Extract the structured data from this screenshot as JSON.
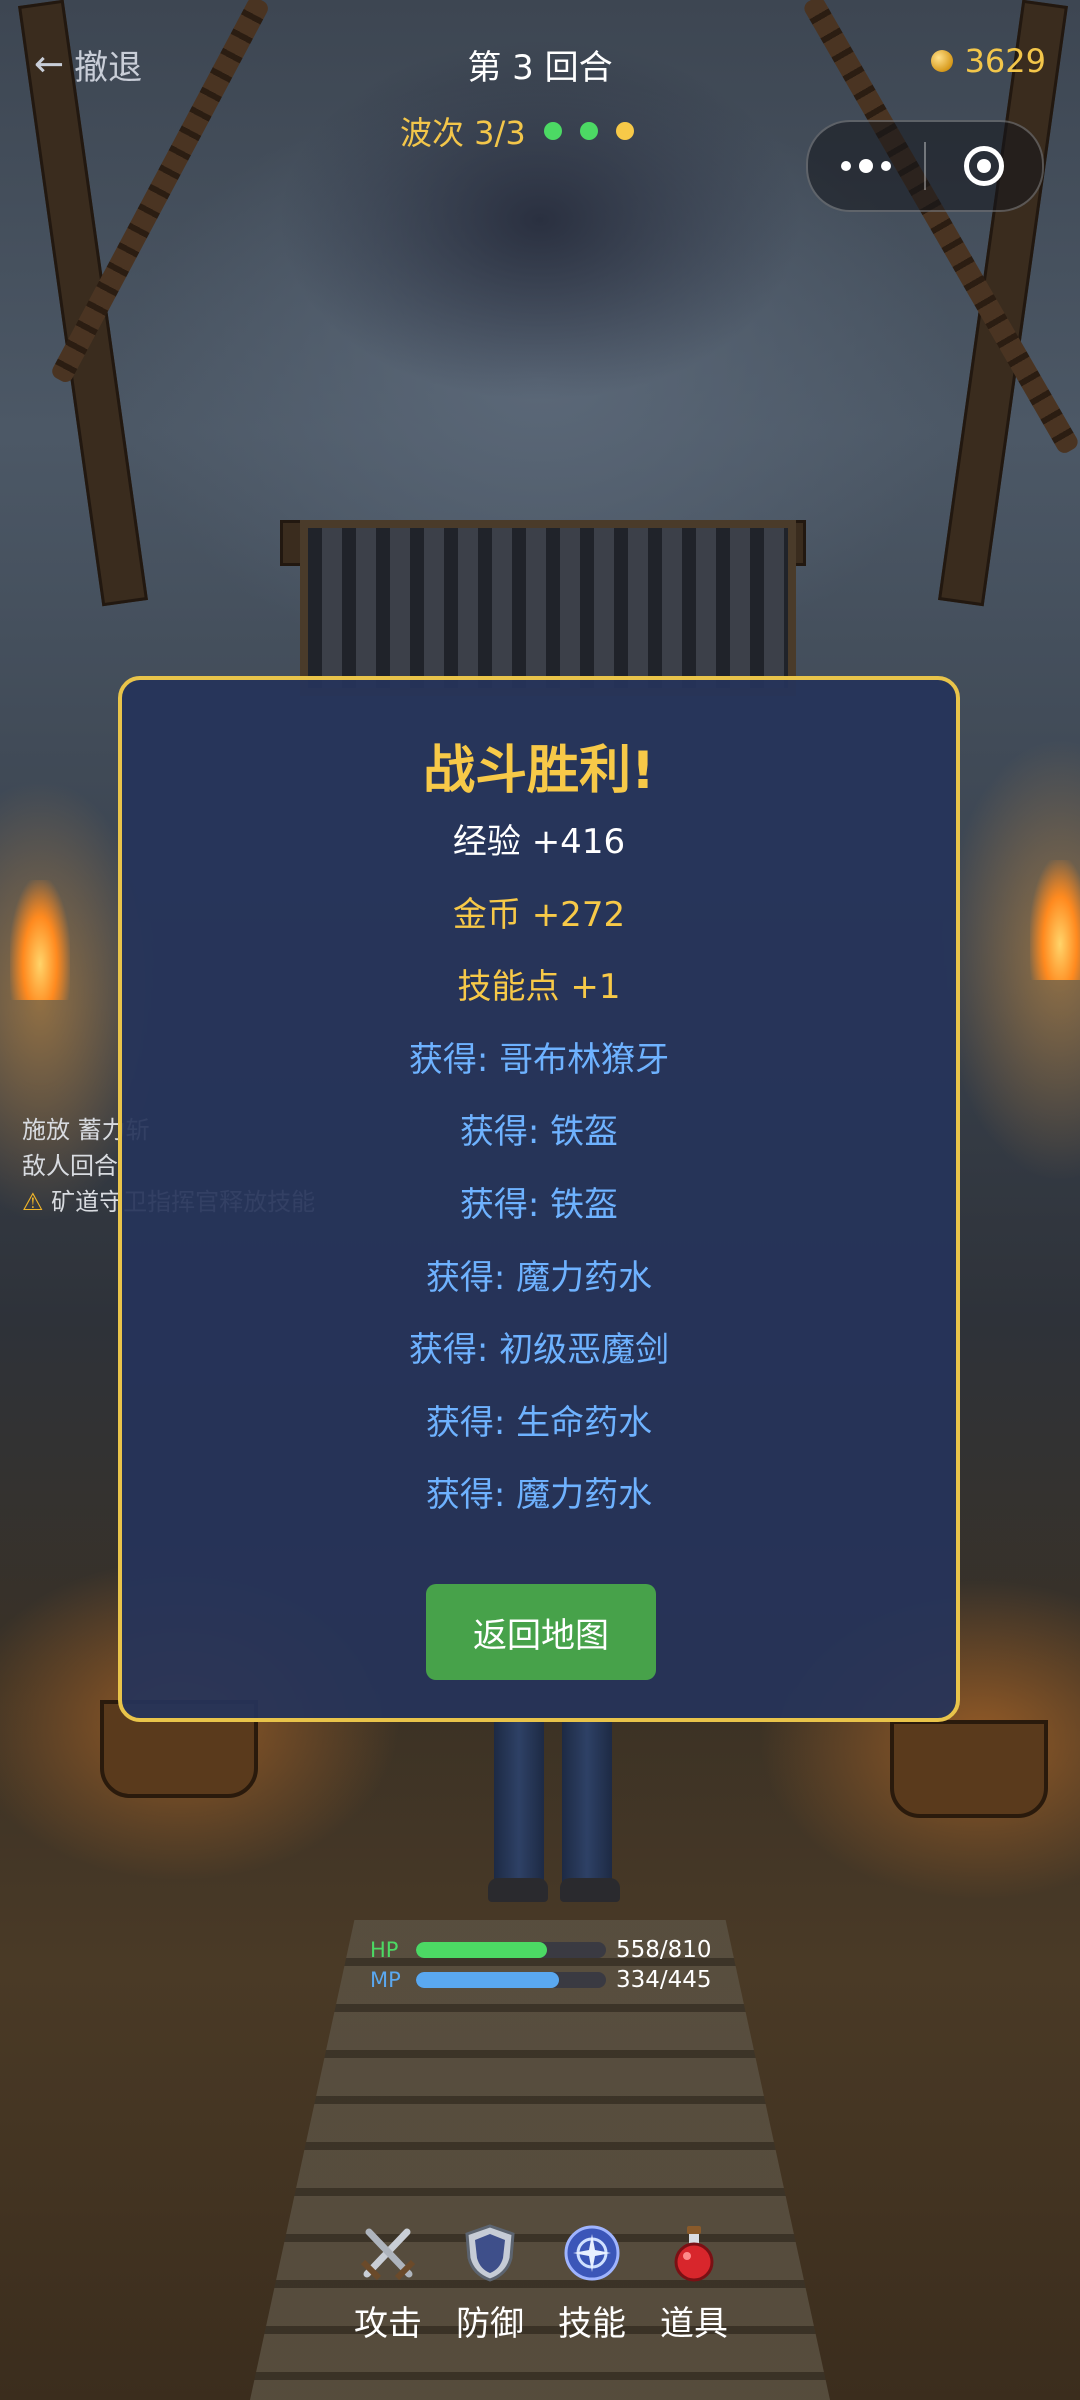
{
  "topbar": {
    "back_label": "撤退",
    "round_label": "第 3 回合",
    "gold": "3629",
    "wave_label": "波次 3/3",
    "wave_dots": [
      "#4cd964",
      "#4cd964",
      "#f7c948"
    ]
  },
  "battle_log": {
    "line1": "施放 蓄力斩",
    "line2": "敌人回合",
    "line3": "矿道守卫指挥官释放技能"
  },
  "modal": {
    "title": "战斗胜利!",
    "rewards": [
      {
        "text": "经验 +416",
        "kind": "white"
      },
      {
        "text": "金币 +272",
        "kind": "gold"
      },
      {
        "text": "技能点 +1",
        "kind": "gold"
      },
      {
        "text": "获得: 哥布林獠牙",
        "kind": "blue"
      },
      {
        "text": "获得: 铁盔",
        "kind": "blue"
      },
      {
        "text": "获得: 铁盔",
        "kind": "blue"
      },
      {
        "text": "获得: 魔力药水",
        "kind": "blue"
      },
      {
        "text": "获得: 初级恶魔剑",
        "kind": "blue"
      },
      {
        "text": "获得: 生命药水",
        "kind": "blue"
      },
      {
        "text": "获得: 魔力药水",
        "kind": "blue"
      }
    ],
    "return_label": "返回地图"
  },
  "hero": {
    "hp_label": "HP",
    "hp_text": "558/810",
    "hp_fraction": 0.689,
    "hp_color": "#4cd964",
    "mp_label": "MP",
    "mp_text": "334/445",
    "mp_fraction": 0.751,
    "mp_color": "#5aa8f0"
  },
  "actions": [
    {
      "label": "攻击",
      "icon": "crossed-swords-icon"
    },
    {
      "label": "防御",
      "icon": "shield-icon"
    },
    {
      "label": "技能",
      "icon": "magic-orb-icon"
    },
    {
      "label": "道具",
      "icon": "potion-icon"
    }
  ]
}
